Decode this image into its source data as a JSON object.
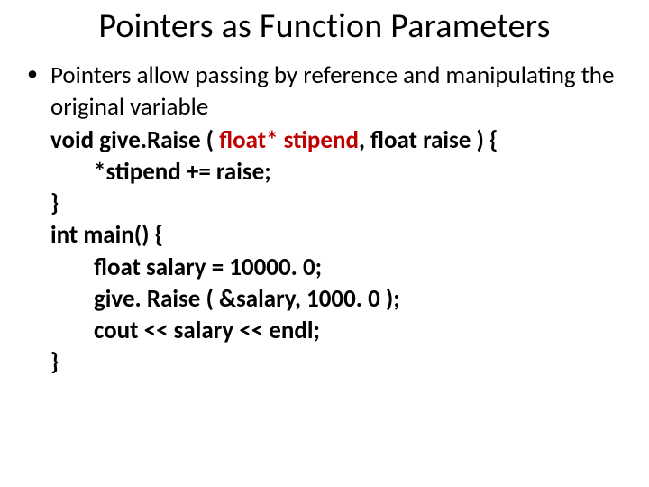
{
  "title": "Pointers as Function Parameters",
  "bullet": {
    "dot": "•",
    "text": "Pointers allow passing by reference and manipulating the original variable"
  },
  "code": {
    "l1_a": "void give.Raise ( ",
    "l1_b": "float* stipend",
    "l1_c": ", float raise ) {",
    "l2": "*stipend += raise;",
    "l3": "}",
    "l4": "int main() {",
    "l5": "float salary = 10000. 0;",
    "l6": "give. Raise ( &salary, 1000. 0 );",
    "l7": "cout << salary << endl;",
    "l8": "}"
  }
}
